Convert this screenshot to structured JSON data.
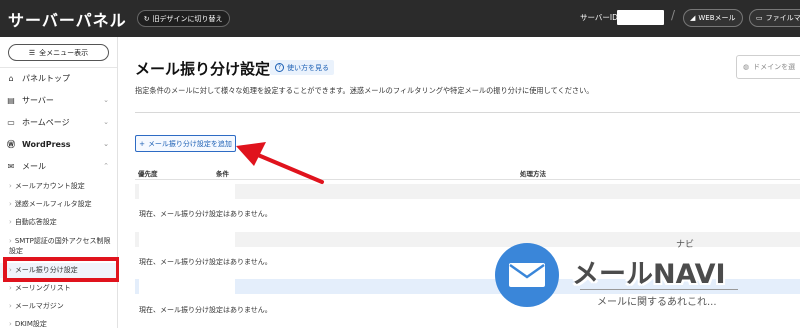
{
  "topbar": {
    "brand": "サーバーパネル",
    "old_design_label": "旧デザインに切り替え",
    "server_id_label": "サーバーID",
    "separator": "/",
    "webmail_label": "WEBメール",
    "filemanager_label": "ファイルマネ"
  },
  "sidebar": {
    "menu_button": "全メニュー表示",
    "items": [
      {
        "label": "パネルトップ",
        "icon": "home-icon"
      },
      {
        "label": "サーバー",
        "icon": "server-icon"
      },
      {
        "label": "ホームページ",
        "icon": "window-icon"
      },
      {
        "label": "WordPress",
        "icon": "wordpress-icon"
      },
      {
        "label": "メール",
        "icon": "mail-icon"
      }
    ],
    "mail_sub_items": [
      "メールアカウント設定",
      "迷惑メールフィルタ設定",
      "自動応答設定",
      "SMTP認証の国外アクセス制限設定",
      "メール振り分け設定",
      "メーリングリスト",
      "メールマガジン",
      "DKIM設定"
    ],
    "active_item": "メール振り分け設定"
  },
  "main": {
    "title": "メール振り分け設定",
    "howto_label": "使い方を見る",
    "domain_select_placeholder": "ドメインを選",
    "description": "指定条件のメールに対して様々な処理を設定することができます。迷惑メールのフィルタリングや特定メールの振り分けに使用してください。",
    "add_button": "メール振り分け設定を追加",
    "columns": [
      "優先度",
      "条件",
      "処理方法"
    ],
    "empty_message": "現在、メール振り分け設定はありません。"
  },
  "watermark": {
    "title": "メールNAVI",
    "ruby": "ナビ",
    "subtitle": "メールに関するあれこれ..."
  },
  "colors": {
    "topbar": "#2b2b2b",
    "accent": "#1b5fb4",
    "highlight_red": "#e0131d",
    "watermark_blue": "#3a86d9"
  }
}
